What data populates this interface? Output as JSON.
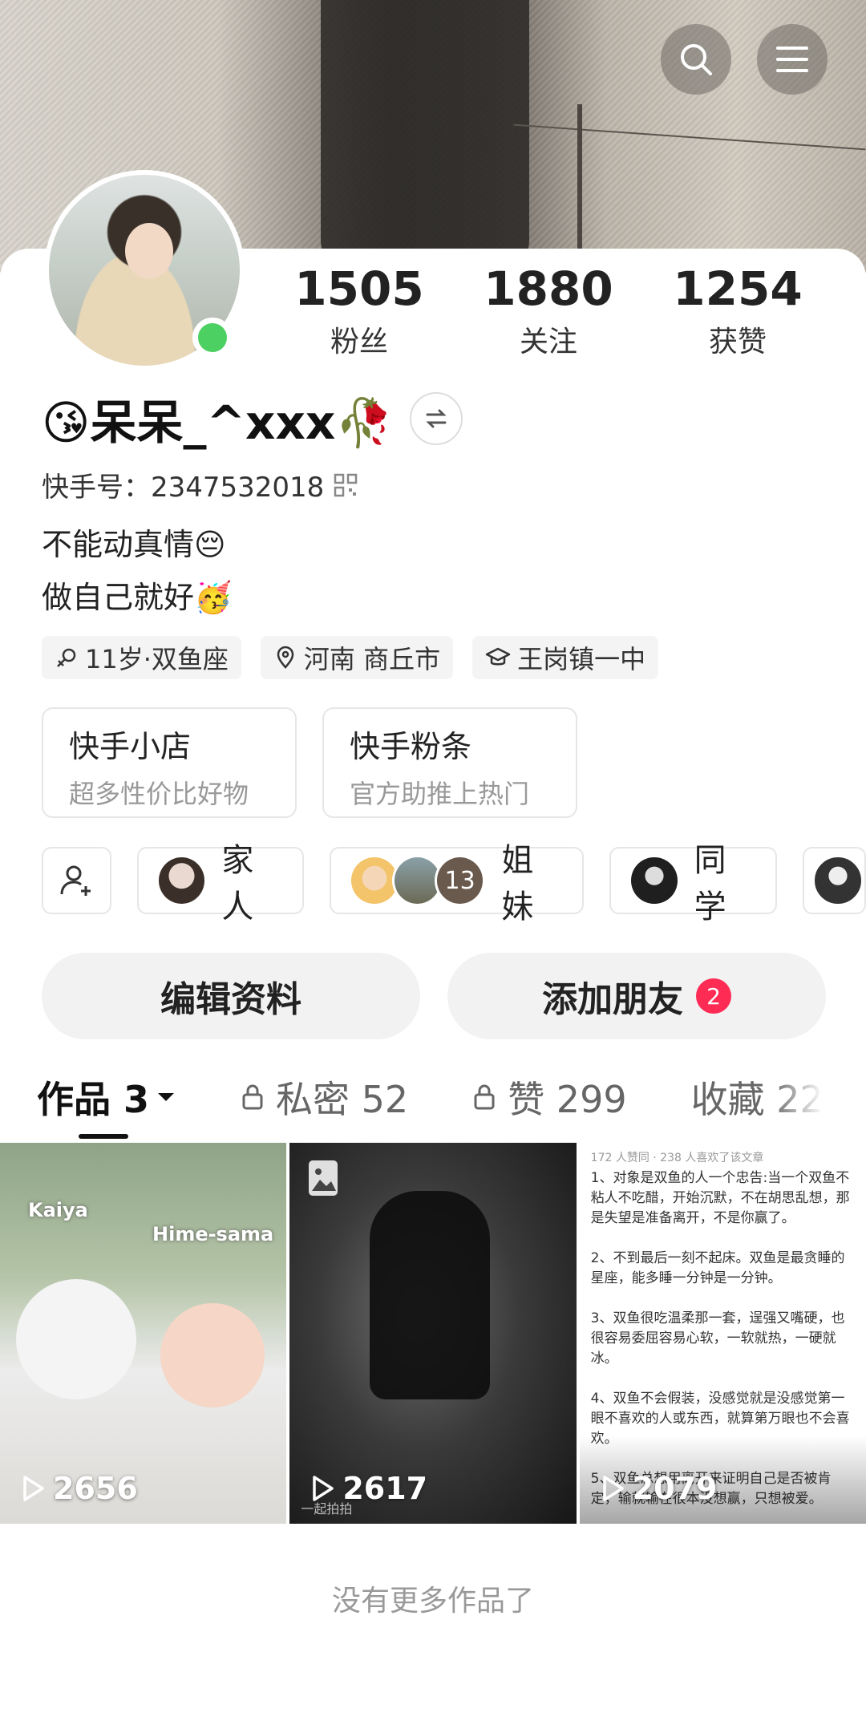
{
  "stats": [
    {
      "value": "1505",
      "label": "粉丝"
    },
    {
      "value": "1880",
      "label": "关注"
    },
    {
      "value": "1254",
      "label": "获赞"
    }
  ],
  "profile": {
    "name": "😘呆呆_^xxx🥀",
    "kuaishou_id": "快手号：2347532018",
    "bio_line1": "不能动真情😔",
    "bio_line2": "做自己就好🥳"
  },
  "tags": [
    {
      "icon": "gender-female-icon",
      "label": "11岁·双鱼座"
    },
    {
      "icon": "location-pin-icon",
      "label": "河南 商丘市"
    },
    {
      "icon": "graduation-cap-icon",
      "label": "王岗镇一中"
    }
  ],
  "cards": [
    {
      "title": "快手小店",
      "subtitle": "超多性价比好物"
    },
    {
      "title": "快手粉条",
      "subtitle": "官方助推上热门"
    }
  ],
  "groups": [
    {
      "label": "家人"
    },
    {
      "count": "13",
      "label": "姐妹"
    },
    {
      "label": "同学"
    }
  ],
  "actions": {
    "edit_profile": "编辑资料",
    "add_friends": "添加朋友",
    "add_friends_badge": "2"
  },
  "tabs": [
    {
      "label": "作品 3"
    },
    {
      "label": "私密 52"
    },
    {
      "label": "赞 299"
    },
    {
      "label": "收藏 22"
    }
  ],
  "works": [
    {
      "plays": "2656",
      "overlay_text_1": "Kaiya",
      "overlay_text_2": "Hime-sama"
    },
    {
      "plays": "2617",
      "overlay_text_1": "一起拍拍"
    },
    {
      "plays": "2079",
      "header": "172 人赞同 · 238 人喜欢了该文章",
      "body": "1、对象是双鱼的人一个忠告:当一个双鱼不粘人不吃醋，开始沉默，不在胡思乱想，那是失望是准备离开，不是你赢了。\n\n2、不到最后一刻不起床。双鱼是最贪睡的星座，能多睡一分钟是一分钟。\n\n3、双鱼很吃温柔那一套，逞强又嘴硬，也很容易委屈容易心软，一软就热，一硬就冰。\n\n4、双鱼不会假装，没感觉就是没感觉第一眼不喜欢的人或东西，就算第万眼也不会喜欢。\n\n5、双鱼总想用离开来证明自己是否被肯定，输就输在很本没想赢，只想被爱。"
    }
  ],
  "footer": {
    "no_more": "没有更多作品了"
  },
  "colors": {
    "accent": "#fe2c55",
    "online": "#4cd062"
  }
}
